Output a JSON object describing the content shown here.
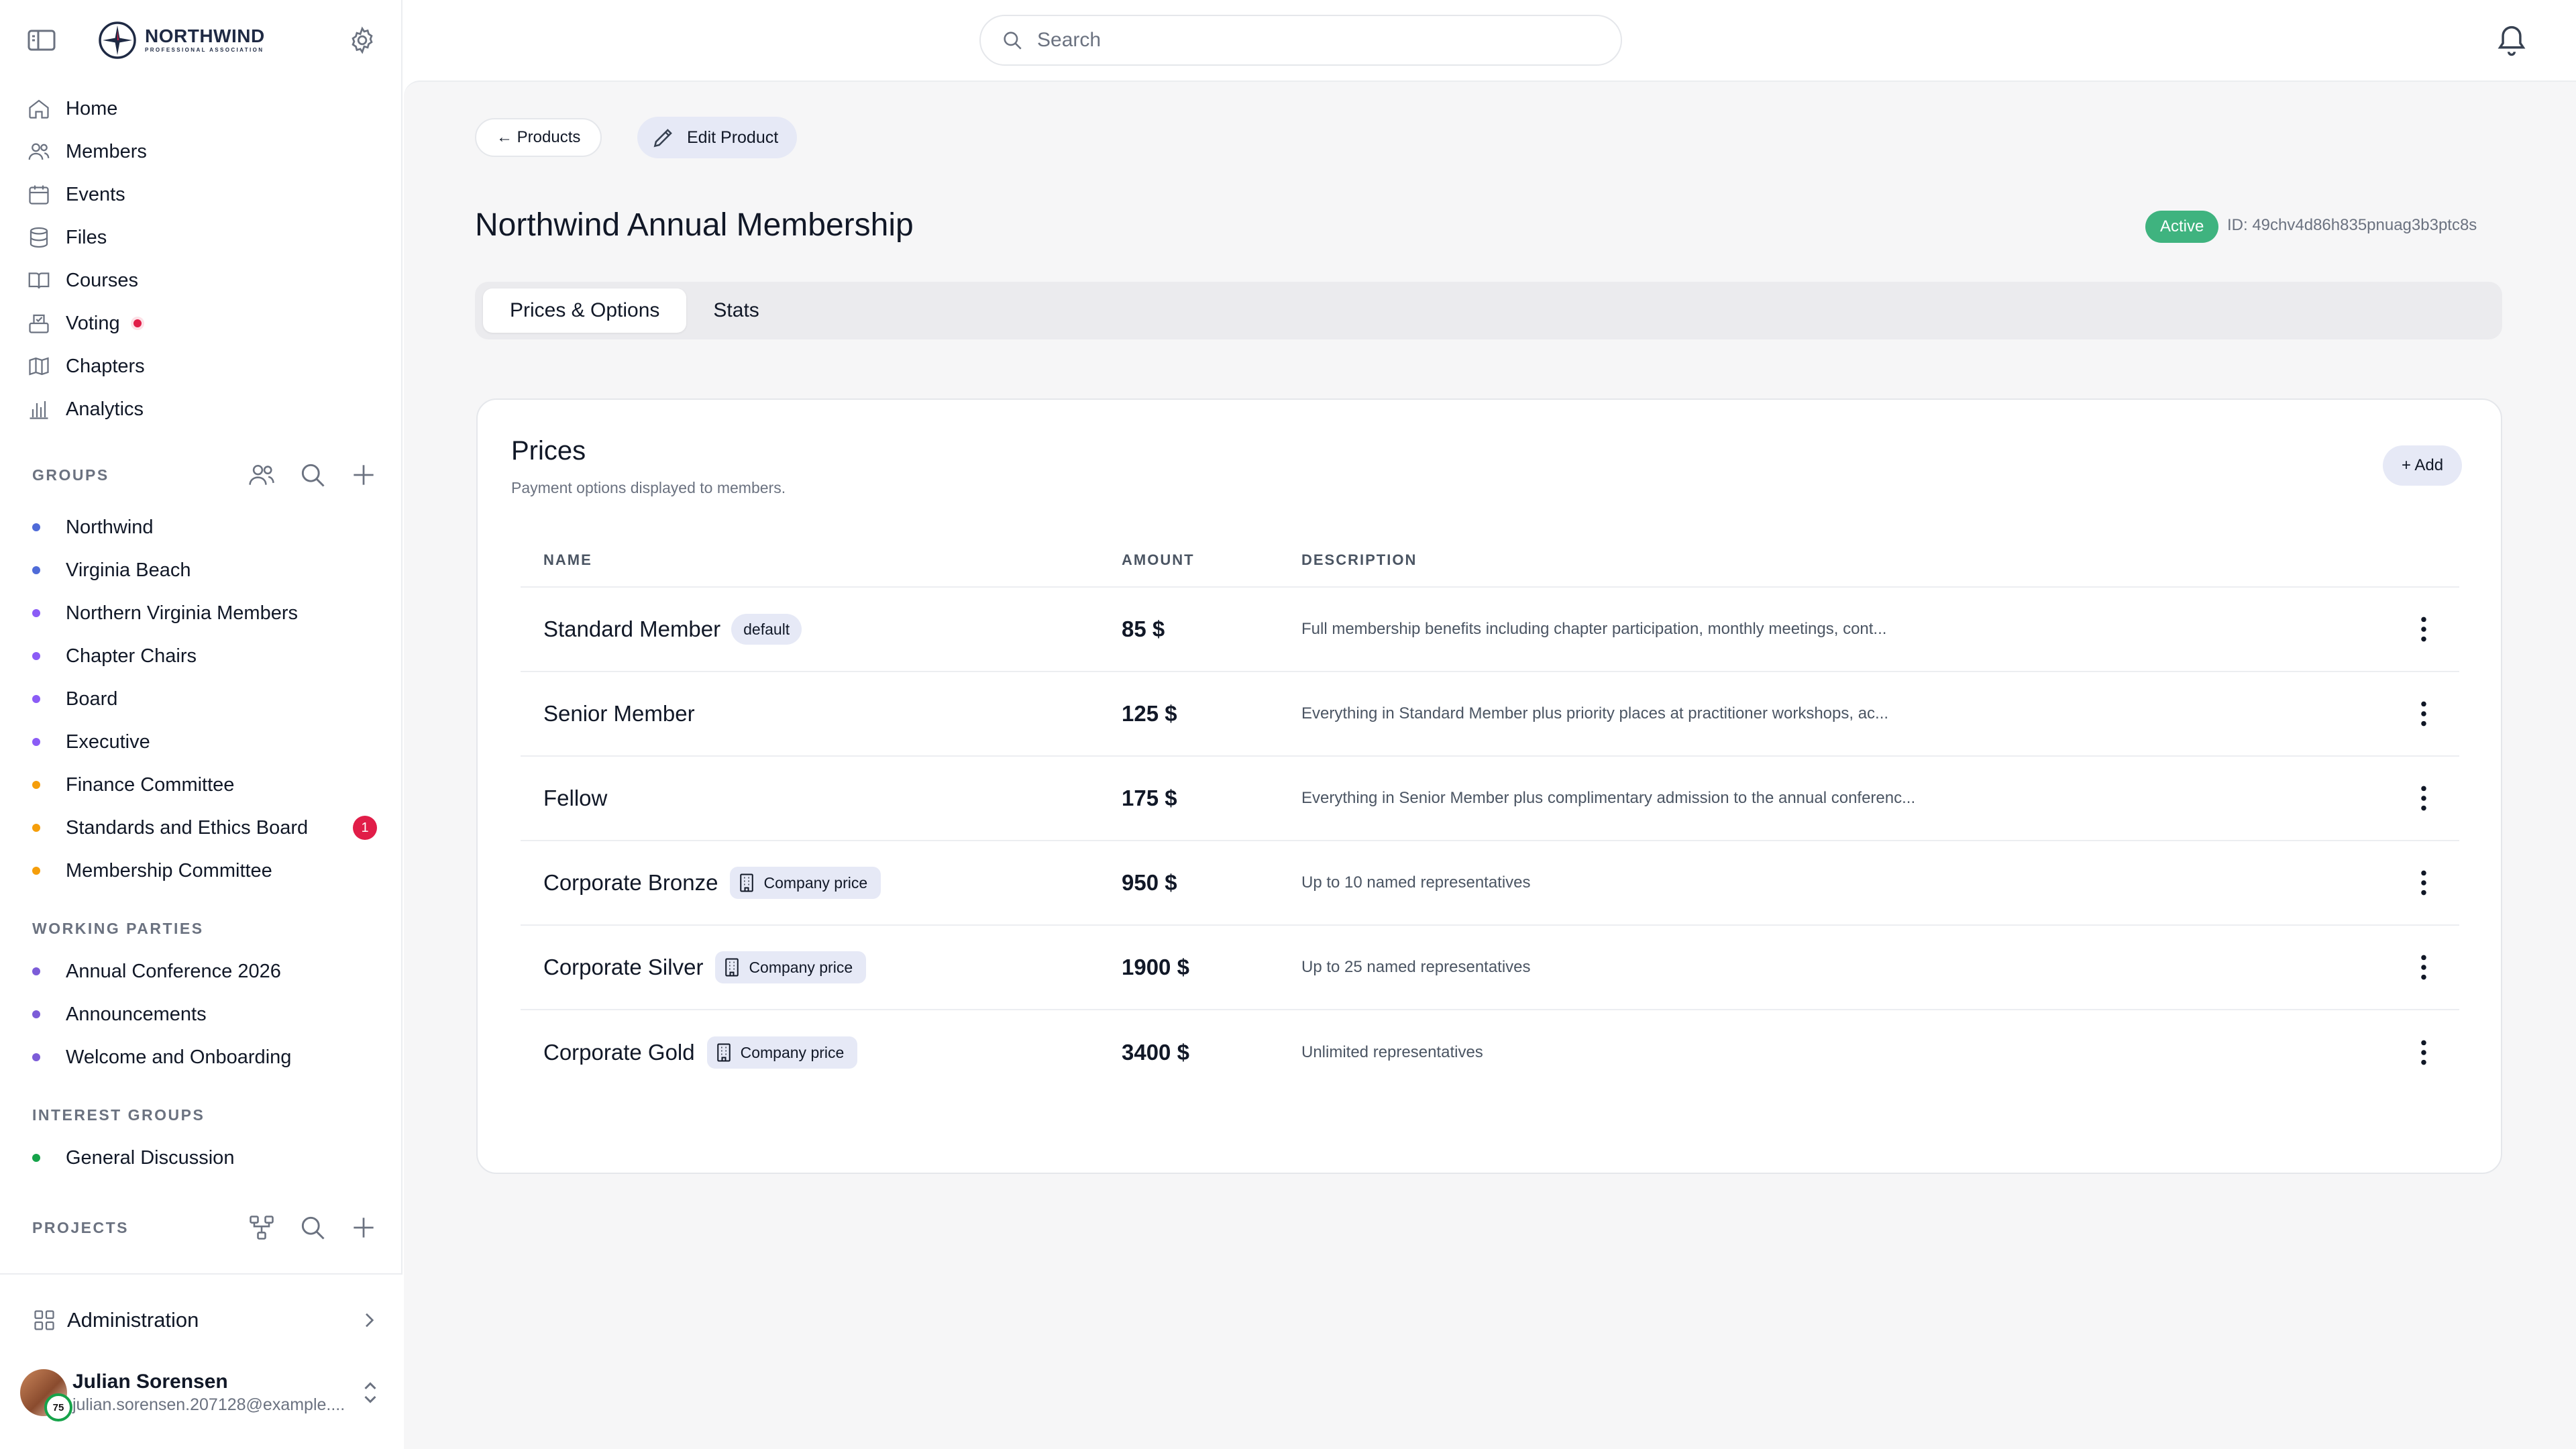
{
  "brand": {
    "name": "NORTHWIND",
    "tagline": "PROFESSIONAL ASSOCIATION"
  },
  "search": {
    "placeholder": "Search"
  },
  "nav": [
    {
      "label": "Home",
      "icon": "home-icon"
    },
    {
      "label": "Members",
      "icon": "members-icon"
    },
    {
      "label": "Events",
      "icon": "calendar-icon"
    },
    {
      "label": "Files",
      "icon": "database-icon"
    },
    {
      "label": "Courses",
      "icon": "book-icon"
    },
    {
      "label": "Voting",
      "icon": "ballot-icon",
      "dot": true
    },
    {
      "label": "Chapters",
      "icon": "map-icon"
    },
    {
      "label": "Analytics",
      "icon": "chart-icon"
    }
  ],
  "groups": {
    "title": "GROUPS",
    "items": [
      {
        "label": "Northwind",
        "color": "#4f6bd8"
      },
      {
        "label": "Virginia Beach",
        "color": "#4f6bd8"
      },
      {
        "label": "Northern Virginia Members",
        "color": "#8b5cf6"
      },
      {
        "label": "Chapter Chairs",
        "color": "#8b5cf6"
      },
      {
        "label": "Board",
        "color": "#8b5cf6"
      },
      {
        "label": "Executive",
        "color": "#8b5cf6"
      },
      {
        "label": "Finance Committee",
        "color": "#f59e0b"
      },
      {
        "label": "Standards and Ethics Board",
        "color": "#f59e0b",
        "badge": "1"
      },
      {
        "label": "Membership Committee",
        "color": "#f59e0b"
      }
    ]
  },
  "working_parties": {
    "title": "WORKING PARTIES",
    "items": [
      {
        "label": "Annual Conference 2026",
        "color": "#7c5cd8"
      },
      {
        "label": "Announcements",
        "color": "#7c5cd8"
      },
      {
        "label": "Welcome and Onboarding",
        "color": "#7c5cd8"
      }
    ]
  },
  "interest_groups": {
    "title": "INTEREST GROUPS",
    "items": [
      {
        "label": "General Discussion",
        "color": "#16a34a"
      }
    ]
  },
  "projects": {
    "title": "PROJECTS"
  },
  "admin": {
    "label": "Administration"
  },
  "user": {
    "name": "Julian Sorensen",
    "email": "julian.sorensen.207128@example....",
    "level": "75"
  },
  "page": {
    "back_label": "← Products",
    "edit_label": "Edit Product",
    "title": "Northwind Annual Membership",
    "status": "Active",
    "id_text": "ID: 49chv4d86h835pnuag3b3ptc8s",
    "tabs": [
      "Prices & Options",
      "Stats"
    ]
  },
  "prices": {
    "title": "Prices",
    "subtitle": "Payment options displayed to members.",
    "add_label": "+ Add",
    "columns": [
      "NAME",
      "AMOUNT",
      "DESCRIPTION"
    ],
    "rows": [
      {
        "name": "Standard Member",
        "tag": "default",
        "amount": "85 $",
        "description": "Full membership benefits including chapter participation, monthly meetings, cont..."
      },
      {
        "name": "Senior Member",
        "tag": "",
        "amount": "125 $",
        "description": "Everything in Standard Member plus priority places at practitioner workshops, ac..."
      },
      {
        "name": "Fellow",
        "tag": "",
        "amount": "175 $",
        "description": "Everything in Senior Member plus complimentary admission to the annual conferenc..."
      },
      {
        "name": "Corporate Bronze",
        "tag": "Company price",
        "amount": "950 $",
        "description": "Up to 10 named representatives"
      },
      {
        "name": "Corporate Silver",
        "tag": "Company price",
        "amount": "1900 $",
        "description": "Up to 25 named representatives"
      },
      {
        "name": "Corporate Gold",
        "tag": "Company price",
        "amount": "3400 $",
        "description": "Unlimited representatives"
      }
    ]
  }
}
